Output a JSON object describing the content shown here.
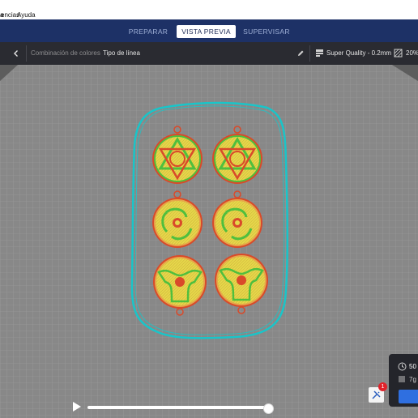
{
  "menubar": {
    "items": [
      "a",
      "encias",
      "Ayuda"
    ]
  },
  "stages": [
    {
      "label": "PREPARAR",
      "active": false
    },
    {
      "label": "VISTA PREVIA",
      "active": true
    },
    {
      "label": "SUPERVISAR",
      "active": false
    }
  ],
  "subbar": {
    "color_scheme_label": "Combinación de colores",
    "color_scheme_value": "Tipo de línea",
    "profile": "Super Quality - 0.2mm",
    "infill": "20%"
  },
  "print_info": {
    "time": "50",
    "weight": "7g"
  },
  "notification_count": "1",
  "playback": {
    "progress": 1.0
  },
  "colors": {
    "outline_skirt": "#19c5c9",
    "wall_outer": "#d94a2a",
    "wall_inner": "#4fbf3e",
    "infill": "#e6d84a",
    "build_plate": "#848484",
    "grid": "#9c9c9c",
    "topbar": "#1d3166"
  },
  "icons": [
    "chevron-left-icon",
    "pencil-icon",
    "printer-profile-icon",
    "infill-icon",
    "clock-icon",
    "weight-icon",
    "play-icon",
    "tools-icon"
  ]
}
